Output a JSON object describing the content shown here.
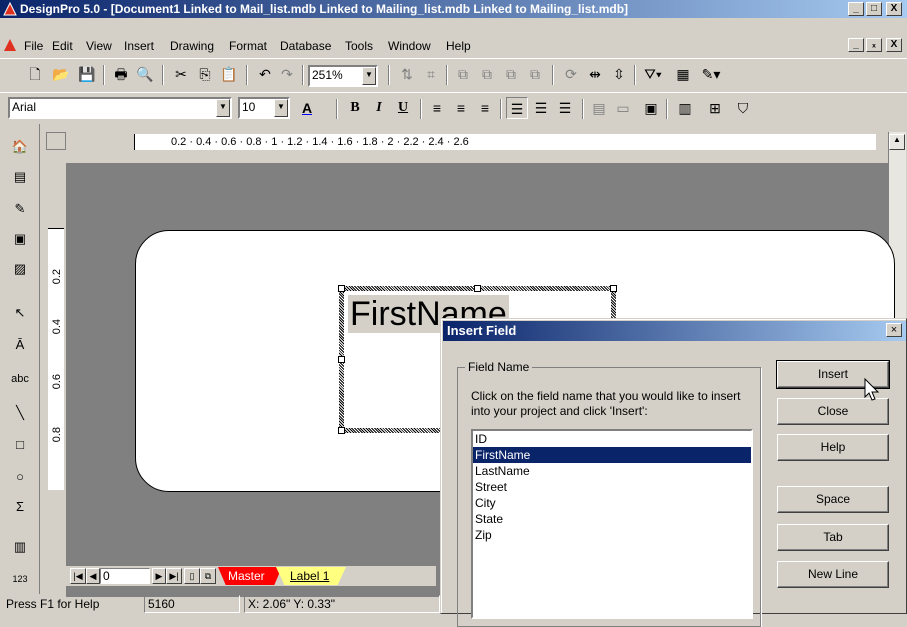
{
  "window": {
    "title": "DesignPro 5.0 - [Document1 Linked to Mail_list.mdb Linked to Mailing_list.mdb Linked to Mailing_list.mdb]",
    "min": "_",
    "max": "□",
    "close": "X",
    "doc_min": "_",
    "doc_restore": "ₓ",
    "doc_close": "X"
  },
  "menu": [
    "File",
    "Edit",
    "View",
    "Insert",
    "Drawing",
    "Format",
    "Database",
    "Tools",
    "Window",
    "Help"
  ],
  "toolbar": {
    "zoom": "251%",
    "font": "Arial",
    "size": "10",
    "bold": "B",
    "italic": "I",
    "underline": "U",
    "font_color": "A"
  },
  "ruler": {
    "h": "0.2   ·   0.4   ·   0.6   ·   0.8   ·   1   ·   1.2   ·   1.4   ·   1.6   ·   1.8   ·   2   ·   2.2   ·   2.4   ·   2.6",
    "v": [
      "0.2",
      "0.4",
      "0.6",
      "0.8"
    ]
  },
  "canvas": {
    "field_text": "FirstName"
  },
  "dialog": {
    "title": "Insert Field",
    "close": "×",
    "group_label": "Field Name",
    "hint": "Click on the field name that you would like to insert into your project and click 'Insert':",
    "fields": [
      "ID",
      "FirstName",
      "LastName",
      "Street",
      "City",
      "State",
      "Zip"
    ],
    "selected_index": 1,
    "buttons": {
      "insert": "Insert",
      "close": "Close",
      "help": "Help",
      "space": "Space",
      "tab": "Tab",
      "newline": "New Line"
    }
  },
  "pagebar": {
    "page": "0",
    "tabs": [
      "Master",
      "Label 1"
    ]
  },
  "status": {
    "help": "Press F1 for Help",
    "count": "5160",
    "coords": "X: 2.06\"  Y: 0.33\""
  }
}
